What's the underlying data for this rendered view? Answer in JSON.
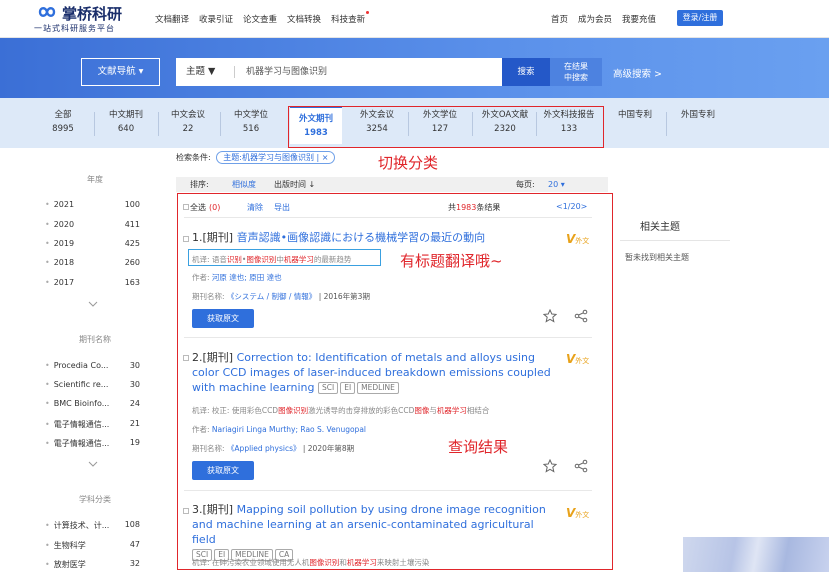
{
  "header": {
    "logo_title": "掌桥科研",
    "logo_sub": "一站式科研服务平台",
    "nav": [
      "文档翻译",
      "收录引证",
      "论文查重",
      "文档转换",
      "科技查新"
    ],
    "right_nav": [
      "首页",
      "成为会员",
      "我要充值"
    ],
    "login": "登录/注册"
  },
  "search": {
    "nav_button": "文献导航",
    "field": "主题",
    "query": "机器学习与图像识别",
    "search_button": "搜索",
    "refine_line1": "在结果",
    "refine_line2": "中搜索",
    "advanced": "高级搜索 >"
  },
  "tabs": [
    {
      "label": "全部",
      "count": "8995"
    },
    {
      "label": "中文期刊",
      "count": "640"
    },
    {
      "label": "中文会议",
      "count": "22"
    },
    {
      "label": "中文学位",
      "count": "516"
    },
    {
      "label": "外文期刊",
      "count": "1983"
    },
    {
      "label": "外文会议",
      "count": "3254"
    },
    {
      "label": "外文学位",
      "count": "127"
    },
    {
      "label": "外文OA文献",
      "count": "2320"
    },
    {
      "label": "外文科技报告",
      "count": "133"
    },
    {
      "label": "中国专利",
      "count": ""
    },
    {
      "label": "外国专利",
      "count": ""
    }
  ],
  "annotations": {
    "switch": "切换分类",
    "translation": "有标题翻译哦~",
    "results": "查询结果"
  },
  "criteria": {
    "label": "检索条件:",
    "chip": "主题:机器学习与图像识别",
    "chip_close": "×"
  },
  "sort": {
    "label": "排序:",
    "relevance": "相似度",
    "time": "出版时间 ↓",
    "per_page_label": "每页:",
    "per_page": "20"
  },
  "sidebar": {
    "year_title": "年度",
    "years": [
      {
        "label": "2021",
        "count": "100"
      },
      {
        "label": "2020",
        "count": "411"
      },
      {
        "label": "2019",
        "count": "425"
      },
      {
        "label": "2018",
        "count": "260"
      },
      {
        "label": "2017",
        "count": "163"
      }
    ],
    "journal_title": "期刊名称",
    "journals": [
      {
        "label": "Procedia Co...",
        "count": "30"
      },
      {
        "label": "Scientific re...",
        "count": "30"
      },
      {
        "label": "BMC Bioinfo...",
        "count": "24"
      },
      {
        "label": "電子情報通信...",
        "count": "21"
      },
      {
        "label": "電子情報通信...",
        "count": "19"
      }
    ],
    "subject_title": "学科分类",
    "subjects": [
      {
        "label": "计算技术、计...",
        "count": "108"
      },
      {
        "label": "生物科学",
        "count": "47"
      },
      {
        "label": "放射医学",
        "count": "32"
      }
    ]
  },
  "results_bar": {
    "select_all": "全选",
    "selected": "(0)",
    "clear": "清除",
    "export": "导出",
    "total_prefix": "共",
    "total": "1983",
    "total_suffix": "条结果",
    "page": "<1/20>"
  },
  "results": [
    {
      "prefix": "1.[期刊]",
      "title": "音声認識•画像認識における機械学習の最近の動向",
      "tags": [],
      "trans_label": "机译:",
      "trans_a": "语音",
      "trans_b": "识别",
      "trans_c": "•",
      "trans_d": "图像识别",
      "trans_e": "中",
      "trans_f": "机器学习",
      "trans_g": "的最新趋势",
      "author_label": "作者:",
      "authors": "河原 達也;  原田 達也",
      "journal_label": "期刊名称:",
      "journal": "《システム / 制御 / 情報》",
      "issue": "| 2016年第3期",
      "button": "获取原文",
      "badge": "外文"
    },
    {
      "prefix": "2.[期刊]",
      "title": "Correction to: Identification of metals and alloys using color CCD images of laser-induced breakdown emissions coupled with machine learning",
      "tags": [
        "SCI",
        "EI",
        "MEDLINE"
      ],
      "trans_label": "机译:",
      "trans_a": "校正: 使用彩色CCD",
      "trans_b": "图像识别",
      "trans_c": "激光诱导的击穿排放的彩色CCD",
      "trans_d": "图像",
      "trans_e": "与",
      "trans_f": "机器学习",
      "trans_g": "相结合",
      "author_label": "作者:",
      "authors": "Nariagiri Linga Murthy;  Rao S. Venugopal",
      "journal_label": "期刊名称:",
      "journal": "《Applied physics》",
      "issue": "| 2020年第8期",
      "button": "获取原文",
      "badge": "外文"
    },
    {
      "prefix": "3.[期刊]",
      "title": "Mapping soil pollution by using drone image recognition and machine learning at an arsenic-contaminated agricultural field",
      "tags": [
        "SCI",
        "EI",
        "MEDLINE",
        "CA"
      ],
      "trans_label": "机译:",
      "trans_a": "在砷污染农业领域使用无人机",
      "trans_b": "图像识别",
      "trans_c": "和",
      "trans_d": "机器学习",
      "trans_e": "来映射土壤污染",
      "trans_f": "",
      "trans_g": "",
      "badge": "外文"
    }
  ],
  "related": {
    "title": "相关主题",
    "empty": "暂未找到相关主题"
  },
  "colors": {
    "primary": "#2f6fdc",
    "annotation_red": "#e0262b",
    "badge_gold": "#e8a21a"
  }
}
